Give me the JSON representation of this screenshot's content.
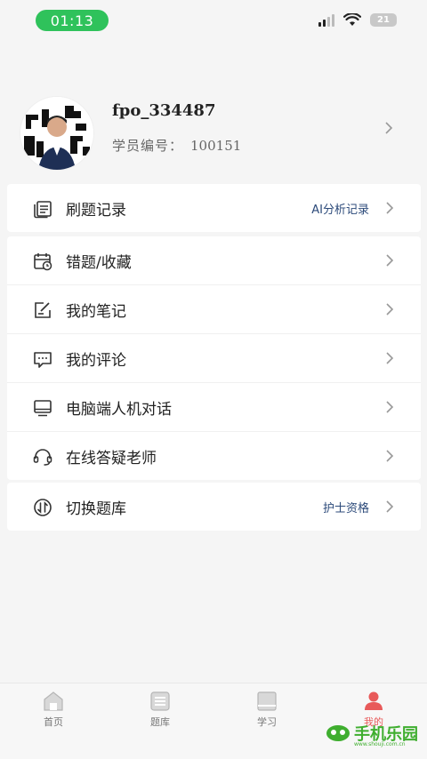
{
  "status": {
    "time": "01:13",
    "battery": "21"
  },
  "profile": {
    "username": "fpo_334487",
    "id_label": "学员编号：",
    "id_value": "100151"
  },
  "menu_group1": [
    {
      "label": "刷题记录",
      "extra": "AI分析记录",
      "icon": "document-list-icon"
    }
  ],
  "menu_group2": [
    {
      "label": "错题/收藏",
      "icon": "calendar-clock-icon"
    },
    {
      "label": "我的笔记",
      "icon": "note-edit-icon"
    },
    {
      "label": "我的评论",
      "icon": "chat-bubble-icon"
    },
    {
      "label": "电脑端人机对话",
      "icon": "monitor-icon"
    },
    {
      "label": "在线答疑老师",
      "icon": "headset-icon"
    }
  ],
  "menu_group3": [
    {
      "label": "切换题库",
      "extra": "护士资格",
      "icon": "switch-icon"
    }
  ],
  "tabbar": [
    {
      "label": "首页",
      "icon": "home-icon"
    },
    {
      "label": "题库",
      "icon": "question-bank-icon"
    },
    {
      "label": "学习",
      "icon": "book-icon"
    },
    {
      "label": "我的",
      "icon": "profile-icon",
      "active": true
    }
  ],
  "watermark": {
    "text": "手机乐园",
    "sub": "www.shouji.com.cn"
  },
  "colors": {
    "accent": "#e85a5a",
    "status_green": "#2fc25b",
    "link_blue": "#2c4a7a",
    "watermark_green": "#3fae2f"
  }
}
